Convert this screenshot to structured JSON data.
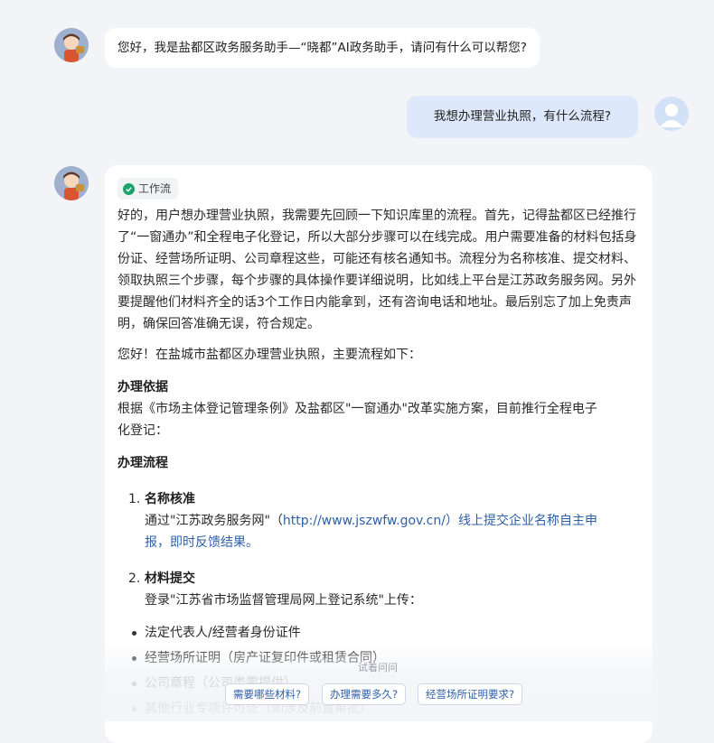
{
  "messages": {
    "greeting": "您好，我是盐都区政务服务助手—“晓都”AI政务助手，请问有什么可以帮您?",
    "user_question": "我想办理营业执照，有什么流程?"
  },
  "answer": {
    "workflow_tag": "工作流",
    "thinking": "好的，用户想办理营业执照，我需要先回顾一下知识库里的流程。首先，记得盐都区已经推行了“一窗通办”和全程电子化登记，所以大部分步骤可以在线完成。用户需要准备的材料包括身份证、经营场所证明、公司章程这些，可能还有核名通知书。流程分为名称核准、提交材料、领取执照三个步骤，每个步骤的具体操作要详细说明，比如线上平台是江苏政务服务网。另外要提醒他们材料齐全的话3个工作日内能拿到，还有咨询电话和地址。最后别忘了加上免责声明，确保回答准确无误，符合规定。",
    "intro": "您好！在盐城市盐都区办理营业执照，主要流程如下：",
    "basis_heading": "办理依据",
    "basis_text_line1": "根据《市场主体登记管理条例》及盐都区\"一窗通办\"改革实施方案，目前推行全程电子",
    "basis_text_line2": "化登记：",
    "process_heading": "办理流程",
    "steps": [
      {
        "num": "1.",
        "title": "名称核准",
        "line1_prefix": "通过\"江苏政务服务网\"（",
        "line1_link": "http://www.jszwfw.gov.cn/）线上提交企业名称自主申",
        "line2_link": "报，即时反馈结果。"
      },
      {
        "num": "2.",
        "title": "材料提交",
        "line1": "登录\"江苏省市场监督管理局网上登记系统\"上传："
      }
    ],
    "materials": [
      "法定代表人/经营者身份证件",
      "经营场所证明（房产证复印件或租赁合同）",
      "公司章程（公司类需提供）",
      "其他行业专项许可证（如涉及前置审批）"
    ]
  },
  "suggestions": {
    "label": "试着问问",
    "chips": [
      "需要哪些材料?",
      "办理需要多久?",
      "经营场所证明要求?"
    ]
  },
  "colors": {
    "page_bg": "#f3f4f7",
    "user_bubble": "#dde8fb",
    "link": "#2f5fa6",
    "check": "#1aa46b"
  }
}
